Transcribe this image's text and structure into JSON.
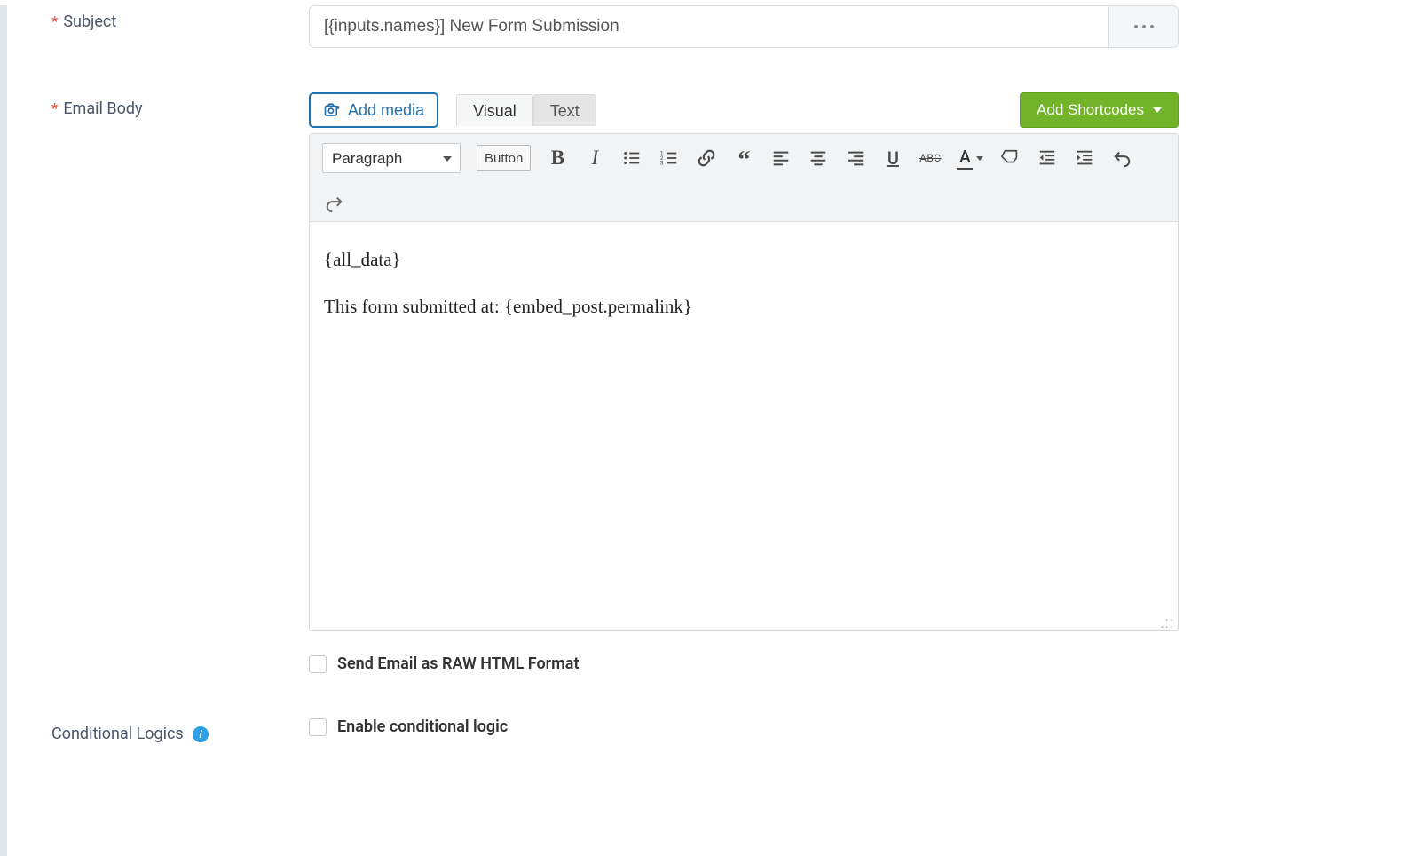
{
  "subject": {
    "label": "Subject",
    "value": "[{inputs.names}] New Form Submission"
  },
  "emailBody": {
    "label": "Email Body",
    "addMedia": "Add media",
    "tabs": {
      "visual": "Visual",
      "text": "Text"
    },
    "shortcodes": "Add Shortcodes",
    "format": "Paragraph",
    "buttonLabel": "Button",
    "content": {
      "line1": "{all_data}",
      "line2": "This form submitted at: {embed_post.permalink}"
    }
  },
  "rawHtml": {
    "label": "Send Email as RAW HTML Format"
  },
  "conditional": {
    "label": "Conditional Logics",
    "enable": "Enable conditional logic"
  }
}
